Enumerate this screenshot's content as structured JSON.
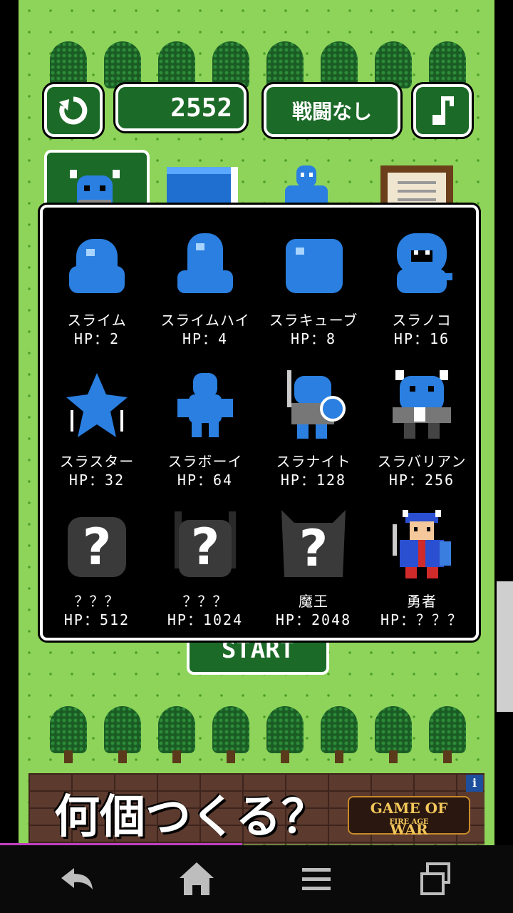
{
  "hud": {
    "reset_icon": "refresh-icon",
    "score": "2552",
    "mode_label": "戦闘なし",
    "music_icon": "music-note-icon"
  },
  "tabs": [
    {
      "name": "monster-tab",
      "icon": "barbarian-icon",
      "active": true
    },
    {
      "name": "book-tab",
      "icon": "book-icon",
      "active": false
    },
    {
      "name": "slime-tab",
      "icon": "slime-icon",
      "active": false
    },
    {
      "name": "board-tab",
      "icon": "notice-board-icon",
      "active": false
    }
  ],
  "monsters": [
    {
      "name": "スライム",
      "hp": "HP：2",
      "icon": "slime-icon"
    },
    {
      "name": "スライムハイ",
      "hp": "HP：4",
      "icon": "tall-slime-icon"
    },
    {
      "name": "スラキューブ",
      "hp": "HP：8",
      "icon": "cube-slime-icon"
    },
    {
      "name": "スラノコ",
      "hp": "HP：16",
      "icon": "snake-slime-icon"
    },
    {
      "name": "スラスター",
      "hp": "HP：32",
      "icon": "star-slime-icon"
    },
    {
      "name": "スラボーイ",
      "hp": "HP：64",
      "icon": "slime-boy-icon"
    },
    {
      "name": "スラナイト",
      "hp": "HP：128",
      "icon": "slime-knight-icon"
    },
    {
      "name": "スラバリアン",
      "hp": "HP：256",
      "icon": "slime-barbarian-icon"
    },
    {
      "name": "？？？",
      "hp": "HP：512",
      "icon": "locked-monster-icon"
    },
    {
      "name": "？？？",
      "hp": "HP：1024",
      "icon": "locked-monster-icon"
    },
    {
      "name": "魔王",
      "hp": "HP：2048",
      "icon": "demon-lord-silhouette-icon"
    },
    {
      "name": "勇者",
      "hp": "HP：？？？",
      "icon": "hero-icon"
    }
  ],
  "start_label": "START",
  "ad": {
    "headline": "何個つくる？",
    "logo": "GAME OF WAR",
    "logo_sub": "FIRE AGE",
    "info": "i"
  },
  "nav": {
    "back_icon": "back-arrow-icon",
    "home_icon": "home-icon",
    "menu_icon": "menu-icon",
    "recents_icon": "recent-apps-icon"
  },
  "colors": {
    "grass": "#8ed45a",
    "panel": "#000000",
    "slime": "#2a7fe0",
    "button_green": "#1c6a28"
  }
}
